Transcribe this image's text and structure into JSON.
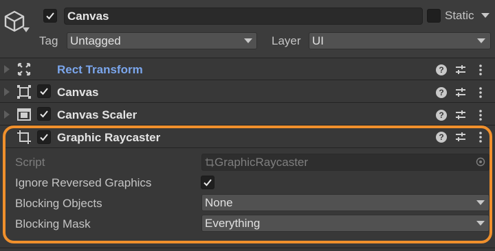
{
  "header": {
    "name": "Canvas",
    "active_checked": true,
    "static_label": "Static",
    "tag_label": "Tag",
    "tag_value": "Untagged",
    "layer_label": "Layer",
    "layer_value": "UI"
  },
  "components": [
    {
      "title": "Rect Transform",
      "icon": "rect-transform-icon",
      "has_checkbox": false
    },
    {
      "title": "Canvas",
      "icon": "canvas-icon",
      "has_checkbox": true
    },
    {
      "title": "Canvas Scaler",
      "icon": "canvas-scaler-icon",
      "has_checkbox": true
    },
    {
      "title": "Graphic Raycaster",
      "icon": "graphic-raycaster-icon",
      "has_checkbox": true,
      "expanded": true
    }
  ],
  "raycaster_fields": {
    "script_label": "Script",
    "script_value": "GraphicRaycaster",
    "ignore_reversed_label": "Ignore Reversed Graphics",
    "ignore_reversed_checked": true,
    "blocking_objects_label": "Blocking Objects",
    "blocking_objects_value": "None",
    "blocking_mask_label": "Blocking Mask",
    "blocking_mask_value": "Everything"
  },
  "colors": {
    "rect_transform_title": "#7ba6ec",
    "highlight_outline": "#f0902c"
  }
}
